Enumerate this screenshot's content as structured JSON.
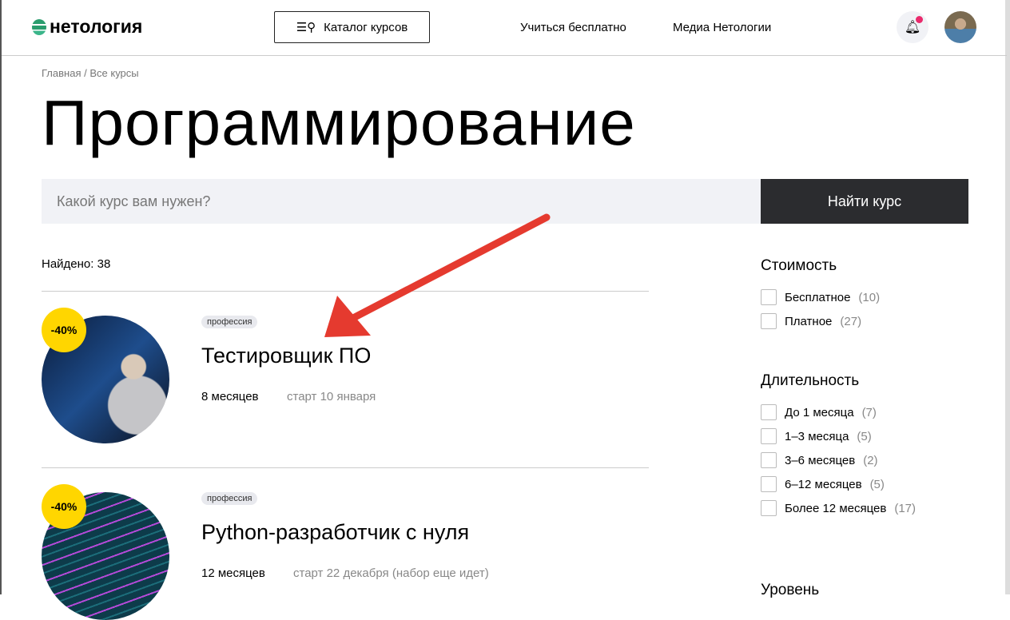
{
  "header": {
    "logo": "нетология",
    "catalog": "Каталог курсов",
    "nav": [
      "Учиться бесплатно",
      "Медиа Нетологии"
    ]
  },
  "breadcrumb": {
    "home": "Главная",
    "sep": "/",
    "current": "Все курсы"
  },
  "page_title": "Программирование",
  "search": {
    "placeholder": "Какой курс вам нужен?",
    "button": "Найти курс"
  },
  "found": "Найдено: 38",
  "courses": [
    {
      "discount": "-40%",
      "tag": "профессия",
      "title": "Тестировщик ПО",
      "duration": "8 месяцев",
      "start": "старт 10 января"
    },
    {
      "discount": "-40%",
      "tag": "профессия",
      "title": "Python-разработчик с нуля",
      "duration": "12 месяцев",
      "start": "старт 22 декабря (набор еще идет)"
    }
  ],
  "filters": {
    "cost": {
      "title": "Стоимость",
      "options": [
        {
          "label": "Бесплатное",
          "count": "(10)"
        },
        {
          "label": "Платное",
          "count": "(27)"
        }
      ]
    },
    "duration": {
      "title": "Длительность",
      "options": [
        {
          "label": "До 1 месяца",
          "count": "(7)"
        },
        {
          "label": "1–3 месяца",
          "count": "(5)"
        },
        {
          "label": "3–6 месяцев",
          "count": "(2)"
        },
        {
          "label": "6–12 месяцев",
          "count": "(5)"
        },
        {
          "label": "Более 12 месяцев",
          "count": "(17)"
        }
      ]
    },
    "level": {
      "title": "Уровень"
    }
  },
  "colors": {
    "accent": "#ffd600",
    "dark": "#2b2c2f",
    "notify": "#ea2a6c",
    "arrow": "#e53a2f"
  }
}
